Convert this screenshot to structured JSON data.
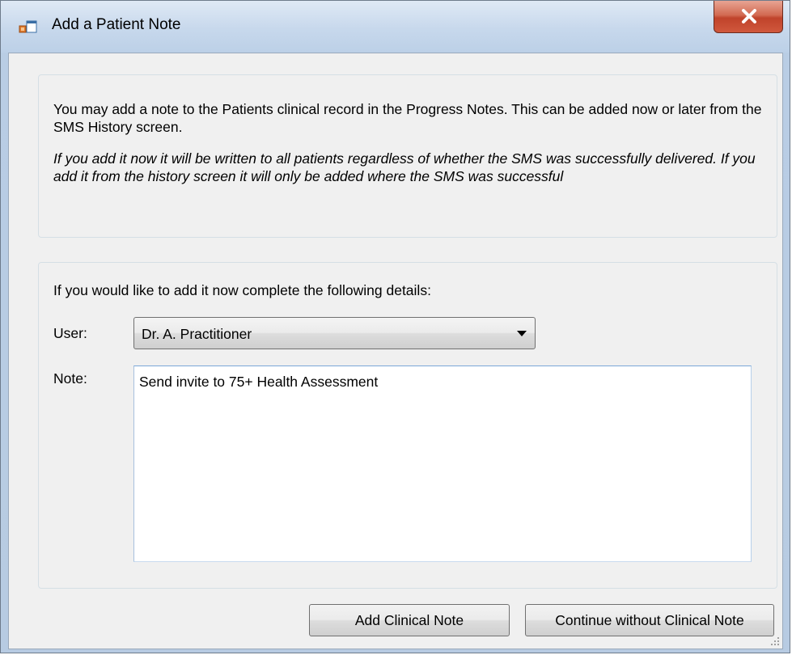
{
  "window": {
    "title": "Add a Patient Note",
    "icon": "app-window-icon",
    "close_icon": "close-icon"
  },
  "info_panel": {
    "text": "You may add a note to the Patients clinical record in the Progress Notes. This can be added now or later from the SMS History screen.",
    "italic_text": "If you add it now it will be written to all patients regardless of whether the SMS was successfully delivered. If you add it from the history screen it will only be added where the SMS was successful"
  },
  "form": {
    "intro": "If you would like to add it now complete the following details:",
    "user_label": "User:",
    "user_value": "Dr. A. Practitioner",
    "note_label": "Note:",
    "note_value": "Send invite to 75+ Health Assessment"
  },
  "buttons": {
    "add_clinical_note": "Add Clinical Note",
    "continue_without": "Continue without Clinical Note"
  }
}
